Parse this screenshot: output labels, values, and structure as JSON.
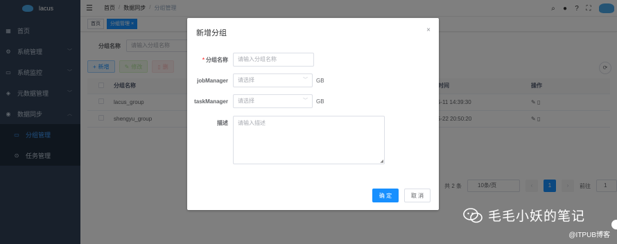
{
  "app": {
    "name": "lacus"
  },
  "sidebar": {
    "items": [
      {
        "label": "首页",
        "icon": "dashboard-icon"
      },
      {
        "label": "系统管理",
        "icon": "gear-icon"
      },
      {
        "label": "系统监控",
        "icon": "monitor-icon"
      },
      {
        "label": "元数据管理",
        "icon": "database-icon"
      },
      {
        "label": "数据同步",
        "icon": "sync-icon"
      }
    ],
    "subitems": [
      {
        "label": "分组管理",
        "icon": "folder-icon",
        "active": true
      },
      {
        "label": "任务管理",
        "icon": "task-icon"
      }
    ]
  },
  "navbar": {
    "breadcrumb": [
      "首页",
      "数据同步",
      "分组管理"
    ],
    "sep": "/"
  },
  "tags": [
    {
      "label": "首页"
    },
    {
      "label": "分组管理",
      "active": true,
      "close": "×"
    }
  ],
  "search": {
    "label": "分组名称",
    "placeholder": "请输入分组名称"
  },
  "toolbar": {
    "add": "新增",
    "edit": "修改",
    "delete": "删"
  },
  "table": {
    "headers": [
      "分组名称",
      "创建时间",
      "操作"
    ],
    "rows": [
      {
        "name": "lacus_group",
        "created": "2023-05-11 14:39:30"
      },
      {
        "name": "shengyu_group",
        "created": "2023-05-22 20:50:20"
      }
    ]
  },
  "pagination": {
    "total": "共 2 条",
    "page_size": "10条/页",
    "current": "1",
    "goto": "前往",
    "goto_value": "1"
  },
  "dialog": {
    "title": "新增分组",
    "close": "×",
    "fields": {
      "group_name": {
        "label": "分组名称",
        "placeholder": "请输入分组名称",
        "required": true
      },
      "job_manager": {
        "label": "jobManager",
        "placeholder": "请选择",
        "unit": "GB"
      },
      "task_manager": {
        "label": "taskManager",
        "placeholder": "请选择",
        "unit": "GB"
      },
      "description": {
        "label": "描述",
        "placeholder": "请输入描述"
      }
    },
    "confirm": "确 定",
    "cancel": "取 消"
  },
  "watermark": {
    "text": "毛毛小妖的笔记",
    "source": "@ITPUB博客"
  },
  "colors": {
    "sidebar": "#304156",
    "primary": "#1890ff",
    "overlay": "rgba(0,0,0,0.5)"
  }
}
